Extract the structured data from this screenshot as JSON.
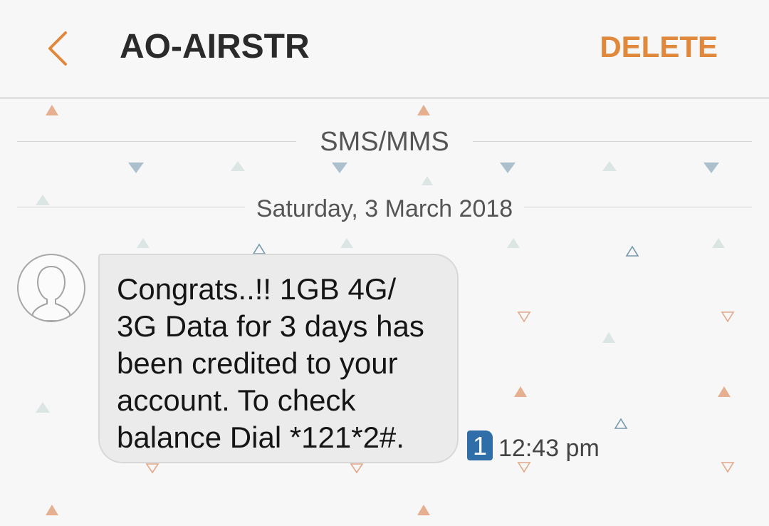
{
  "header": {
    "back_icon": "chevron-left-icon",
    "title": "AO-AIRSTR",
    "delete_label": "DELETE"
  },
  "conversation": {
    "section_label": "SMS/MMS",
    "date_label": "Saturday, 3 March 2018",
    "messages": [
      {
        "avatar_icon": "contact-avatar-icon",
        "text": "Congrats..!! 1GB 4G/\n3G Data for 3 days has\nbeen credited to your\naccount. To check\nbalance Dial *121*2#.",
        "sim_slot": "1",
        "time": "12:43 pm"
      }
    ]
  },
  "colors": {
    "accent": "#e0893c",
    "sim_badge": "#2f6ea8",
    "bubble": "#ebebeb",
    "background": "#f7f7f7"
  }
}
